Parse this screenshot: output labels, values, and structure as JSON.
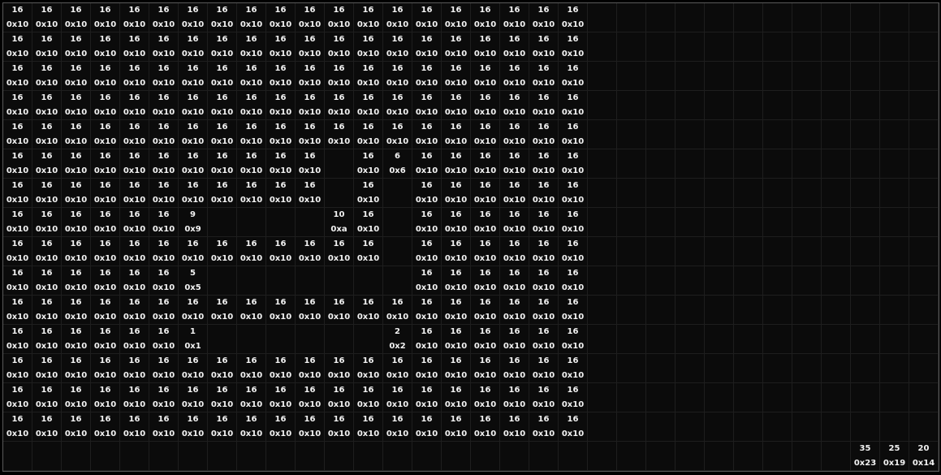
{
  "grid": {
    "columns": 32,
    "rows": 16,
    "cells": [
      [
        "16",
        "16",
        "16",
        "16",
        "16",
        "16",
        "16",
        "16",
        "16",
        "16",
        "16",
        "16",
        "16",
        "16",
        "16",
        "16",
        "16",
        "16",
        "16",
        "16",
        "",
        "",
        "",
        "",
        "",
        "",
        "",
        "",
        "",
        "",
        "",
        ""
      ],
      [
        "16",
        "16",
        "16",
        "16",
        "16",
        "16",
        "16",
        "16",
        "16",
        "16",
        "16",
        "16",
        "16",
        "16",
        "16",
        "16",
        "16",
        "16",
        "16",
        "16",
        "",
        "",
        "",
        "",
        "",
        "",
        "",
        "",
        "",
        "",
        "",
        ""
      ],
      [
        "16",
        "16",
        "16",
        "16",
        "16",
        "16",
        "16",
        "16",
        "16",
        "16",
        "16",
        "16",
        "16",
        "16",
        "16",
        "16",
        "16",
        "16",
        "16",
        "16",
        "",
        "",
        "",
        "",
        "",
        "",
        "",
        "",
        "",
        "",
        "",
        ""
      ],
      [
        "16",
        "16",
        "16",
        "16",
        "16",
        "16",
        "16",
        "16",
        "16",
        "16",
        "16",
        "16",
        "16",
        "16",
        "16",
        "16",
        "16",
        "16",
        "16",
        "16",
        "",
        "",
        "",
        "",
        "",
        "",
        "",
        "",
        "",
        "",
        "",
        ""
      ],
      [
        "16",
        "16",
        "16",
        "16",
        "16",
        "16",
        "16",
        "16",
        "16",
        "16",
        "16",
        "16",
        "16",
        "16",
        "16",
        "16",
        "16",
        "16",
        "16",
        "16",
        "",
        "",
        "",
        "",
        "",
        "",
        "",
        "",
        "",
        "",
        "",
        ""
      ],
      [
        "16",
        "16",
        "16",
        "16",
        "16",
        "16",
        "16",
        "16",
        "16",
        "16",
        "16",
        "",
        "16",
        "6",
        "16",
        "16",
        "16",
        "16",
        "16",
        "16",
        "",
        "",
        "",
        "",
        "",
        "",
        "",
        "",
        "",
        "",
        "",
        ""
      ],
      [
        "16",
        "16",
        "16",
        "16",
        "16",
        "16",
        "16",
        "16",
        "16",
        "16",
        "16",
        "",
        "16",
        "",
        "16",
        "16",
        "16",
        "16",
        "16",
        "16",
        "",
        "",
        "",
        "",
        "",
        "",
        "",
        "",
        "",
        "",
        "",
        ""
      ],
      [
        "16",
        "16",
        "16",
        "16",
        "16",
        "16",
        "9",
        "",
        "",
        "",
        "",
        "10",
        "16",
        "",
        "16",
        "16",
        "16",
        "16",
        "16",
        "16",
        "",
        "",
        "",
        "",
        "",
        "",
        "",
        "",
        "",
        "",
        "",
        ""
      ],
      [
        "16",
        "16",
        "16",
        "16",
        "16",
        "16",
        "16",
        "16",
        "16",
        "16",
        "16",
        "16",
        "16",
        "",
        "16",
        "16",
        "16",
        "16",
        "16",
        "16",
        "",
        "",
        "",
        "",
        "",
        "",
        "",
        "",
        "",
        "",
        "",
        ""
      ],
      [
        "16",
        "16",
        "16",
        "16",
        "16",
        "16",
        "5",
        "",
        "",
        "",
        "",
        "",
        "",
        "",
        "16",
        "16",
        "16",
        "16",
        "16",
        "16",
        "",
        "",
        "",
        "",
        "",
        "",
        "",
        "",
        "",
        "",
        "",
        ""
      ],
      [
        "16",
        "16",
        "16",
        "16",
        "16",
        "16",
        "16",
        "16",
        "16",
        "16",
        "16",
        "16",
        "16",
        "16",
        "16",
        "16",
        "16",
        "16",
        "16",
        "16",
        "",
        "",
        "",
        "",
        "",
        "",
        "",
        "",
        "",
        "",
        "",
        ""
      ],
      [
        "16",
        "16",
        "16",
        "16",
        "16",
        "16",
        "1",
        "",
        "",
        "",
        "",
        "",
        "",
        "2",
        "16",
        "16",
        "16",
        "16",
        "16",
        "16",
        "",
        "",
        "",
        "",
        "",
        "",
        "",
        "",
        "",
        "",
        "",
        ""
      ],
      [
        "16",
        "16",
        "16",
        "16",
        "16",
        "16",
        "16",
        "16",
        "16",
        "16",
        "16",
        "16",
        "16",
        "16",
        "16",
        "16",
        "16",
        "16",
        "16",
        "16",
        "",
        "",
        "",
        "",
        "",
        "",
        "",
        "",
        "",
        "",
        "",
        ""
      ],
      [
        "16",
        "16",
        "16",
        "16",
        "16",
        "16",
        "16",
        "16",
        "16",
        "16",
        "16",
        "16",
        "16",
        "16",
        "16",
        "16",
        "16",
        "16",
        "16",
        "16",
        "",
        "",
        "",
        "",
        "",
        "",
        "",
        "",
        "",
        "",
        "",
        ""
      ],
      [
        "16",
        "16",
        "16",
        "16",
        "16",
        "16",
        "16",
        "16",
        "16",
        "16",
        "16",
        "16",
        "16",
        "16",
        "16",
        "16",
        "16",
        "16",
        "16",
        "16",
        "",
        "",
        "",
        "",
        "",
        "",
        "",
        "",
        "",
        "",
        "",
        ""
      ],
      [
        "",
        "",
        "",
        "",
        "",
        "",
        "",
        "",
        "",
        "",
        "",
        "",
        "",
        "",
        "",
        "",
        "",
        "",
        "",
        "",
        "",
        "",
        "",
        "",
        "",
        "",
        "",
        "",
        "",
        "35",
        "25",
        "20"
      ]
    ]
  },
  "colors": {
    "background": "#0b0b0b",
    "gridline": "#1e1e1e",
    "text": "#f2f2f2",
    "frame": "#5a5a5a"
  }
}
